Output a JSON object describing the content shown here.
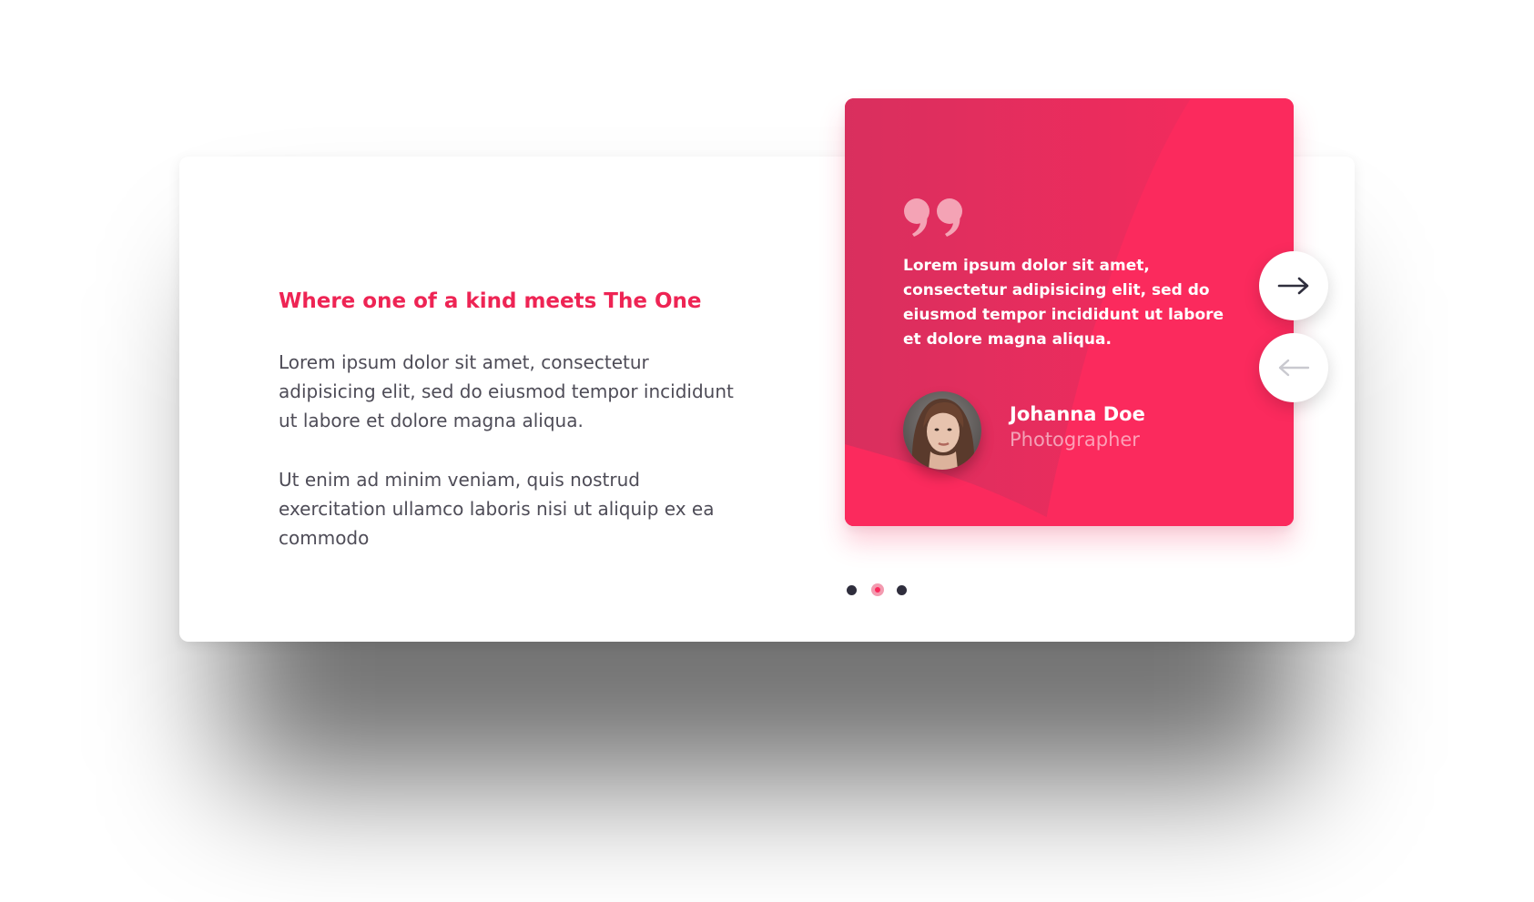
{
  "colors": {
    "accent": "#fb2a5d",
    "accent_dark": "#d5305e",
    "headline": "#ee2454",
    "body_text": "#4e4c57",
    "dot_inactive": "#2f2e3d",
    "dot_active": "#f39bb0"
  },
  "intro": {
    "headline": "Where one of a kind meets The One",
    "paragraphs": [
      "Lorem ipsum dolor sit amet, consectetur adipisicing elit, sed do eiusmod tempor incididunt ut labore et dolore magna aliqua.",
      "Ut enim ad minim veniam, quis nostrud exercitation ullamco laboris nisi ut aliquip ex ea commodo"
    ]
  },
  "testimonial": {
    "quote_icon": "quote-icon",
    "text": "Lorem ipsum dolor sit amet, consectetur adipisicing elit, sed do eiusmod tempor incididunt ut labore et dolore magna aliqua.",
    "author": {
      "name": "Johanna Doe",
      "role": "Photographer"
    }
  },
  "navigation": {
    "next_icon": "arrow-right-icon",
    "prev_icon": "arrow-left-icon",
    "prev_enabled": false
  },
  "pagination": {
    "count": 3,
    "active_index": 1
  }
}
